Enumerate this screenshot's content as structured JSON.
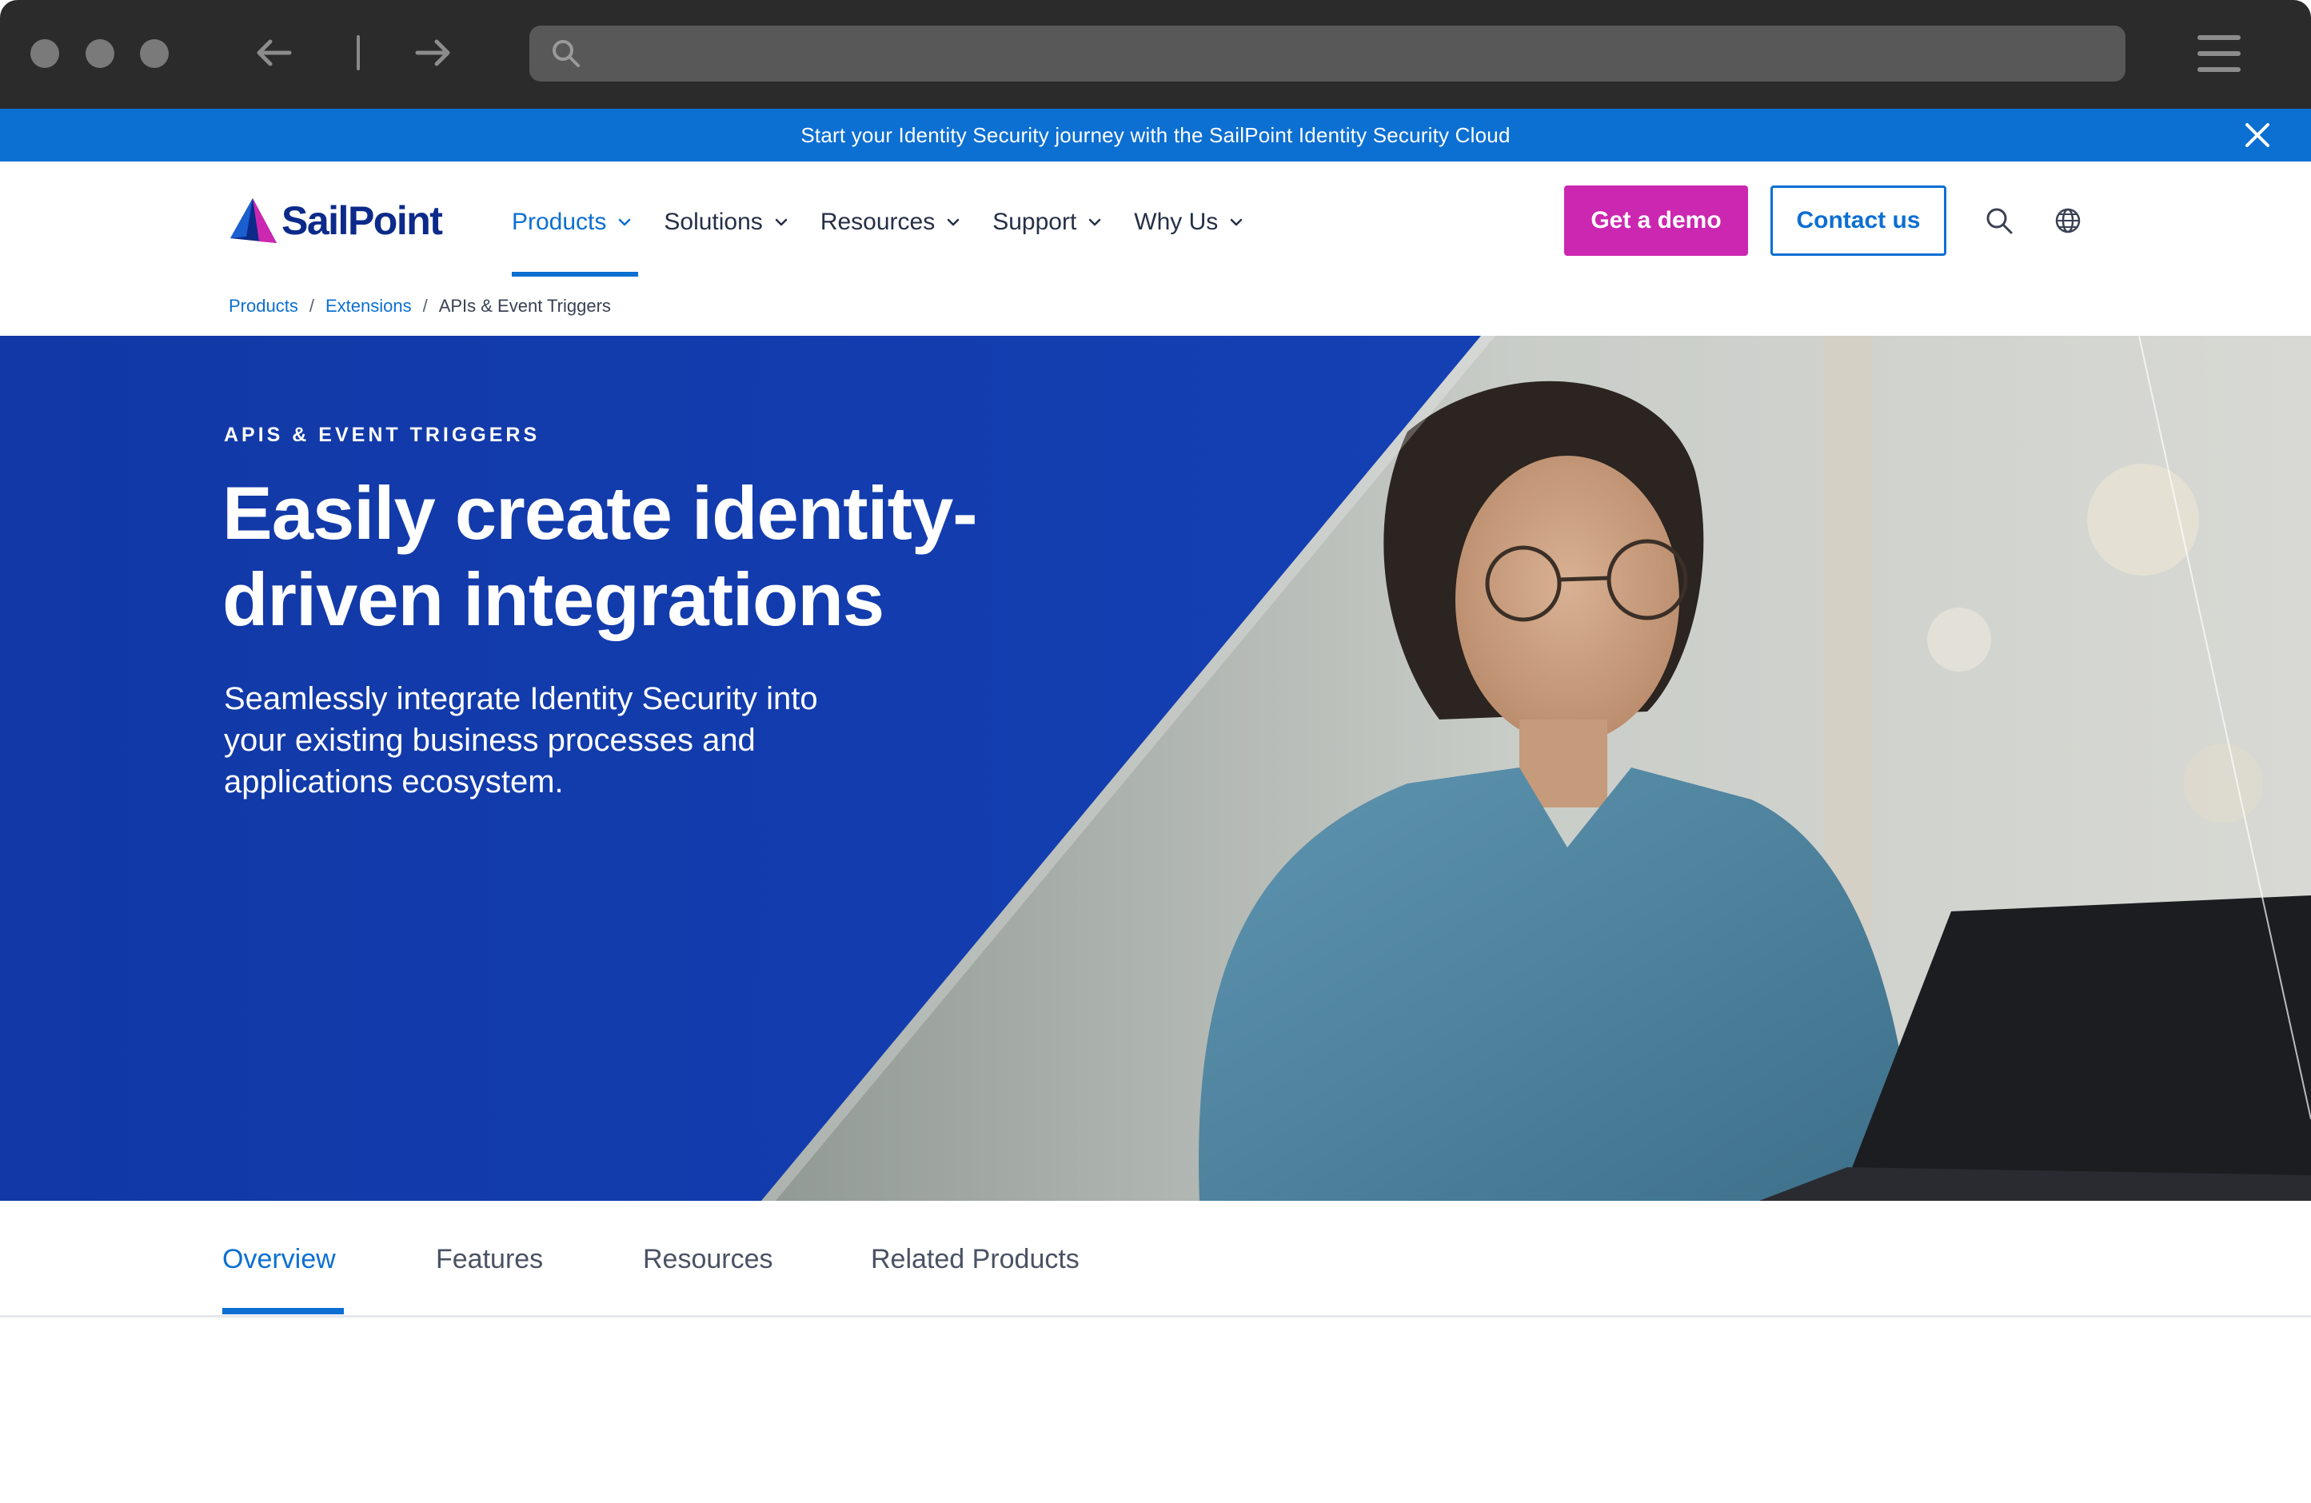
{
  "browser": {
    "back_icon": "arrow-left-icon",
    "forward_icon": "arrow-right-icon",
    "search_icon": "search-icon",
    "address_value": "",
    "menu_icon": "hamburger-menu-icon"
  },
  "announcement": {
    "text": "Start your Identity Security journey with the SailPoint Identity Security Cloud",
    "close_icon": "close-icon",
    "color": "#0c6fd2"
  },
  "header": {
    "logo_text": "SailPoint",
    "nav": [
      {
        "label": "Products",
        "active": true
      },
      {
        "label": "Solutions",
        "active": false
      },
      {
        "label": "Resources",
        "active": false
      },
      {
        "label": "Support",
        "active": false
      },
      {
        "label": "Why Us",
        "active": false
      }
    ],
    "demo_button": "Get a demo",
    "contact_button": "Contact us",
    "search_icon": "search-icon",
    "globe_icon": "globe-icon",
    "accent_color": "#0c6fd2",
    "demo_color": "#cc27b0"
  },
  "breadcrumb": {
    "items": [
      "Products",
      "Extensions"
    ],
    "current": "APIs & Event Triggers"
  },
  "hero": {
    "eyebrow": "APIS & EVENT TRIGGERS",
    "title": "Easily create identity-driven integrations",
    "subtitle": "Seamlessly integrate Identity Security into your existing business processes and applications ecosystem.",
    "background_color": "#123aa8",
    "image": "photo-woman-at-laptop"
  },
  "tabs": [
    {
      "label": "Overview",
      "active": true
    },
    {
      "label": "Features",
      "active": false
    },
    {
      "label": "Resources",
      "active": false
    },
    {
      "label": "Related Products",
      "active": false
    }
  ]
}
